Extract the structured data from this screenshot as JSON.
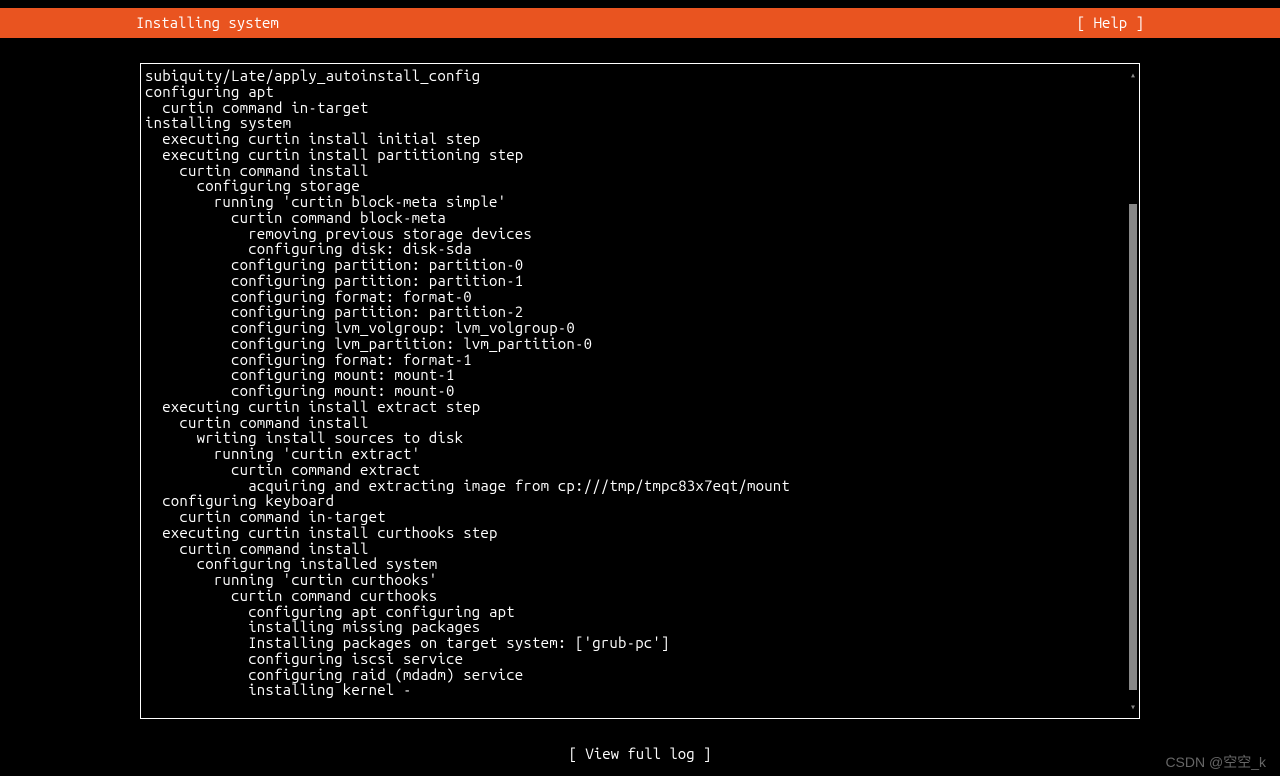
{
  "header": {
    "title": "Installing system",
    "help": "[ Help ]"
  },
  "log": {
    "lines": [
      {
        "indent": 0,
        "text": "subiquity/Late/apply_autoinstall_config"
      },
      {
        "indent": 0,
        "text": "configuring apt"
      },
      {
        "indent": 1,
        "text": "curtin command in-target"
      },
      {
        "indent": 0,
        "text": "installing system"
      },
      {
        "indent": 1,
        "text": "executing curtin install initial step"
      },
      {
        "indent": 1,
        "text": "executing curtin install partitioning step"
      },
      {
        "indent": 2,
        "text": "curtin command install"
      },
      {
        "indent": 3,
        "text": "configuring storage"
      },
      {
        "indent": 4,
        "text": "running 'curtin block-meta simple'"
      },
      {
        "indent": 5,
        "text": "curtin command block-meta"
      },
      {
        "indent": 6,
        "text": "removing previous storage devices"
      },
      {
        "indent": 6,
        "text": "configuring disk: disk-sda"
      },
      {
        "indent": 5,
        "text": "configuring partition: partition-0"
      },
      {
        "indent": 5,
        "text": "configuring partition: partition-1"
      },
      {
        "indent": 5,
        "text": "configuring format: format-0"
      },
      {
        "indent": 5,
        "text": "configuring partition: partition-2"
      },
      {
        "indent": 5,
        "text": "configuring lvm_volgroup: lvm_volgroup-0"
      },
      {
        "indent": 5,
        "text": "configuring lvm_partition: lvm_partition-0"
      },
      {
        "indent": 5,
        "text": "configuring format: format-1"
      },
      {
        "indent": 5,
        "text": "configuring mount: mount-1"
      },
      {
        "indent": 5,
        "text": "configuring mount: mount-0"
      },
      {
        "indent": 1,
        "text": "executing curtin install extract step"
      },
      {
        "indent": 2,
        "text": "curtin command install"
      },
      {
        "indent": 3,
        "text": "writing install sources to disk"
      },
      {
        "indent": 4,
        "text": "running 'curtin extract'"
      },
      {
        "indent": 5,
        "text": "curtin command extract"
      },
      {
        "indent": 6,
        "text": "acquiring and extracting image from cp:///tmp/tmpc83x7eqt/mount"
      },
      {
        "indent": 1,
        "text": "configuring keyboard"
      },
      {
        "indent": 2,
        "text": "curtin command in-target"
      },
      {
        "indent": 1,
        "text": "executing curtin install curthooks step"
      },
      {
        "indent": 2,
        "text": "curtin command install"
      },
      {
        "indent": 3,
        "text": "configuring installed system"
      },
      {
        "indent": 4,
        "text": "running 'curtin curthooks'"
      },
      {
        "indent": 5,
        "text": "curtin command curthooks"
      },
      {
        "indent": 6,
        "text": "configuring apt configuring apt"
      },
      {
        "indent": 6,
        "text": "installing missing packages"
      },
      {
        "indent": 6,
        "text": "Installing packages on target system: ['grub-pc']"
      },
      {
        "indent": 6,
        "text": "configuring iscsi service"
      },
      {
        "indent": 6,
        "text": "configuring raid (mdadm) service"
      },
      {
        "indent": 6,
        "text": "installing kernel -"
      }
    ]
  },
  "footer": {
    "view_log": "[ View full log ]"
  },
  "watermark": "CSDN @空空_k"
}
